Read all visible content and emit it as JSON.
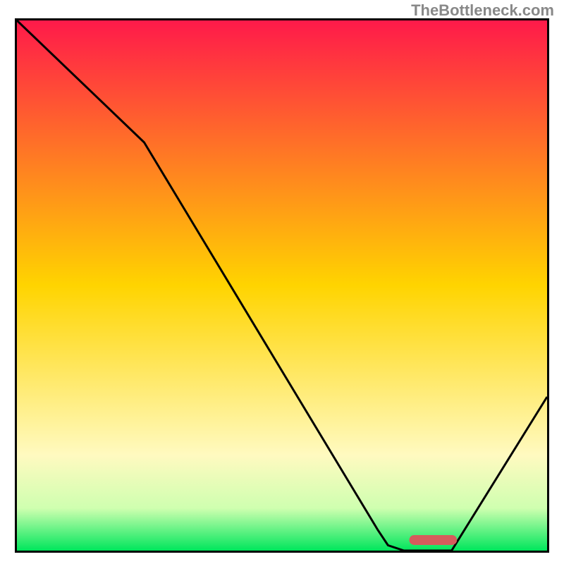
{
  "watermark": "TheBottleneck.com",
  "chart_data": {
    "type": "line",
    "title": "",
    "xlabel": "",
    "ylabel": "",
    "xlim": [
      0,
      100
    ],
    "ylim": [
      0,
      100
    ],
    "curve": [
      {
        "x": 0.0,
        "y": 100.0
      },
      {
        "x": 24.0,
        "y": 77.0
      },
      {
        "x": 68.0,
        "y": 4.0
      },
      {
        "x": 70.0,
        "y": 1.0
      },
      {
        "x": 73.0,
        "y": 0.0
      },
      {
        "x": 82.0,
        "y": 0.0
      },
      {
        "x": 100.0,
        "y": 29.0
      }
    ],
    "marker": {
      "x_start": 74.0,
      "x_end": 83.0,
      "y": 2.0,
      "color": "#d55c5c"
    },
    "gradient_stops": [
      {
        "pos": 0.0,
        "color": "#ff1a4a"
      },
      {
        "pos": 0.5,
        "color": "#ffd400"
      },
      {
        "pos": 0.82,
        "color": "#fffac0"
      },
      {
        "pos": 0.92,
        "color": "#cfffb0"
      },
      {
        "pos": 1.0,
        "color": "#00e65c"
      }
    ]
  }
}
